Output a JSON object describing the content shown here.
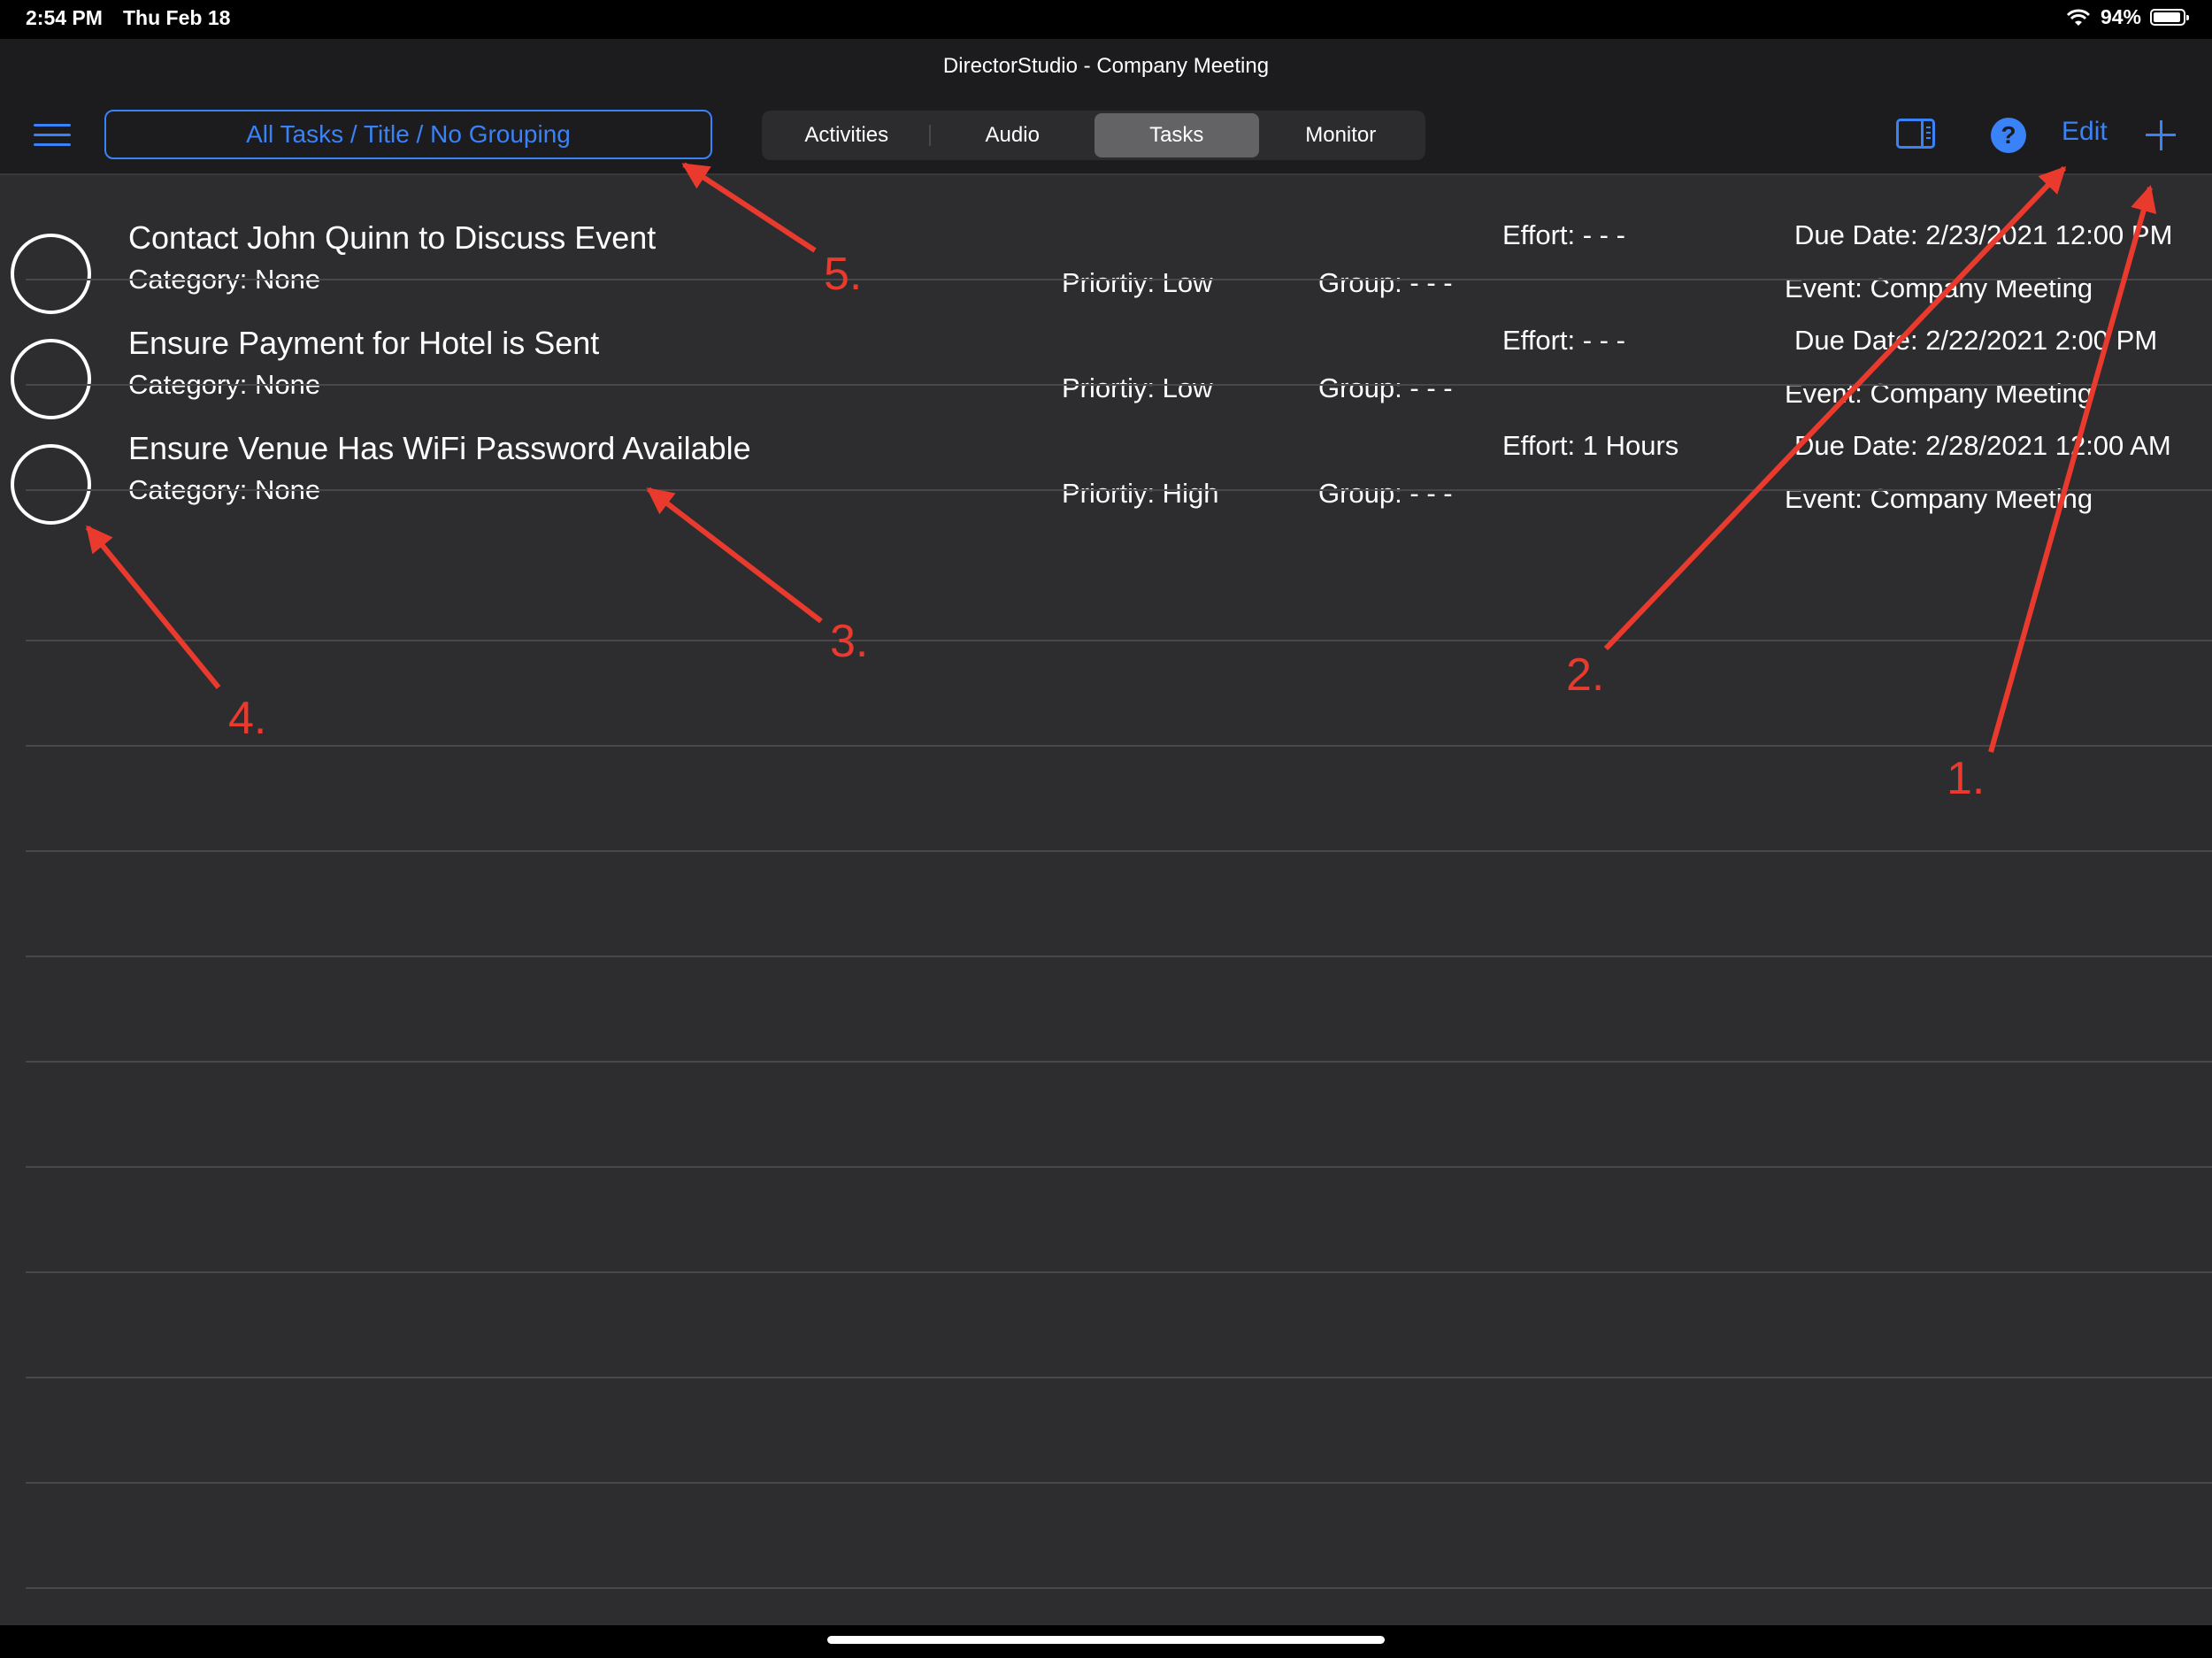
{
  "status_bar": {
    "time": "2:54 PM",
    "date": "Thu Feb 18",
    "battery": "94%"
  },
  "nav": {
    "title": "DirectorStudio - Company Meeting",
    "filter_label": "All Tasks / Title / No Grouping",
    "tabs": [
      "Activities",
      "Audio",
      "Tasks",
      "Monitor"
    ],
    "active_tab": "Tasks",
    "edit_label": "Edit"
  },
  "tasks": [
    {
      "title": "Contact John Quinn to Discuss Event",
      "category": "Category: None",
      "priority": "Priortiy: Low",
      "group": "Group: - - -",
      "effort": "Effort: - - -",
      "due": "Due Date: 2/23/2021 12:00 PM",
      "event": "Event: Company Meeting"
    },
    {
      "title": "Ensure Payment for Hotel is Sent",
      "category": "Category: None",
      "priority": "Priortiy: Low",
      "group": "Group: - - -",
      "effort": "Effort: - - -",
      "due": "Due Date: 2/22/2021 2:00 PM",
      "event": "Event: Company Meeting"
    },
    {
      "title": "Ensure Venue Has WiFi Password Available",
      "category": "Category: None",
      "priority": "Priortiy: High",
      "group": "Group: - - -",
      "effort": "Effort: 1 Hours",
      "due": "Due Date: 2/28/2021 12:00 AM",
      "event": "Event: Company Meeting"
    }
  ],
  "annotations": [
    "1.",
    "2.",
    "3.",
    "4.",
    "5."
  ],
  "colors": {
    "accent": "#3a82f7",
    "annotation": "#ea3a2e",
    "background": "#2d2d2f"
  }
}
